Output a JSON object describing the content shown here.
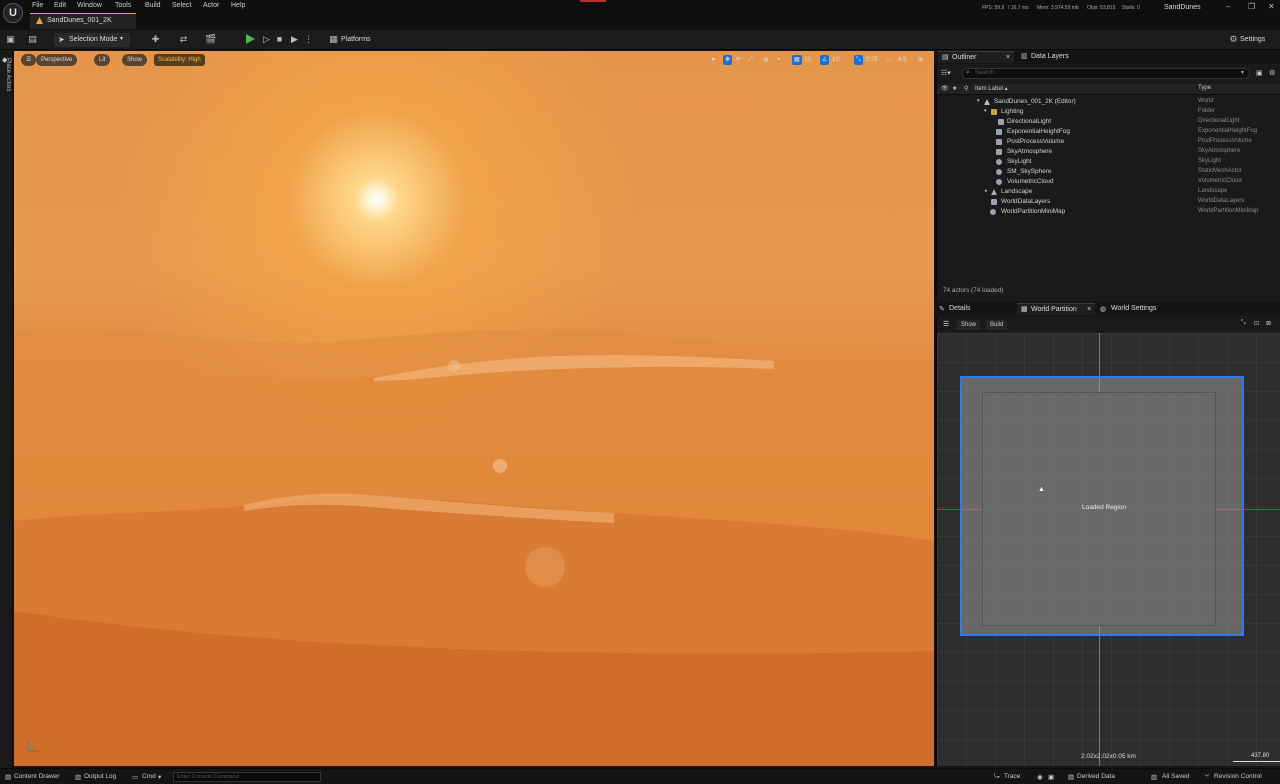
{
  "menu": [
    "File",
    "Edit",
    "Window",
    "Tools",
    "Build",
    "Select",
    "Actor",
    "Help"
  ],
  "level_tab": "SandDunes_001_2K",
  "stats": {
    "fps": "FPS: 59.9",
    "ms": "/ 16.7 ms",
    "mem": "Mem: 3,974.59 mb",
    "objs": "Objs: 53,815",
    "stalls": "Stalls: 0"
  },
  "project_name": "SandDunes",
  "toolbar": {
    "selection_mode": "Selection Mode",
    "platforms": "Platforms",
    "settings": "Settings"
  },
  "left_strip": {
    "place_actors": "Place Actors"
  },
  "viewport": {
    "perspective": "Perspective",
    "lit": "Lit",
    "show": "Show",
    "scalability": "Scalability: High",
    "grid_snap": "10",
    "rot_snap": "10°",
    "scale_snap": "0.25",
    "cam_speed": "4.5"
  },
  "outliner": {
    "tab": "Outliner",
    "data_layers_tab": "Data Layers",
    "search_placeholder": "Search",
    "col_label": "Item Label ▴",
    "col_type": "Type",
    "rows": [
      {
        "name": "SandDunes_001_2K (Editor)",
        "type": "World"
      },
      {
        "name": "Lighting",
        "type": "Folder"
      },
      {
        "name": "DirectionalLight",
        "type": "DirectionalLight"
      },
      {
        "name": "ExponentialHeightFog",
        "type": "ExponentialHeightFog"
      },
      {
        "name": "PostProcessVolume",
        "type": "PostProcessVolume"
      },
      {
        "name": "SkyAtmosphere",
        "type": "SkyAtmosphere"
      },
      {
        "name": "SkyLight",
        "type": "SkyLight"
      },
      {
        "name": "SM_SkySphere",
        "type": "StaticMeshActor"
      },
      {
        "name": "VolumetricCloud",
        "type": "VolumetricCloud"
      },
      {
        "name": "Landscape",
        "type": "Landscape"
      },
      {
        "name": "WorldDataLayers",
        "type": "WorldDataLayers"
      },
      {
        "name": "WorldPartitionMiniMap",
        "type": "WorldPartitionMiniMap"
      }
    ],
    "actors_count": "74 actors (74 loaded)"
  },
  "details_tabs": {
    "details": "Details",
    "world_partition": "World Partition",
    "world_settings": "World Settings"
  },
  "world_partition": {
    "show": "Show",
    "build": "Build",
    "loaded_region": "Loaded Region",
    "dims": "2.02x2.02x0.05 km",
    "scale": "437.80"
  },
  "statusbar": {
    "content_drawer": "Content Drawer",
    "output_log": "Output Log",
    "cmd": "Cmd",
    "console_placeholder": "Enter Console Command",
    "trace": "Trace",
    "derived_data": "Derived Data",
    "all_saved": "All Saved",
    "revision_control": "Revision Control"
  }
}
